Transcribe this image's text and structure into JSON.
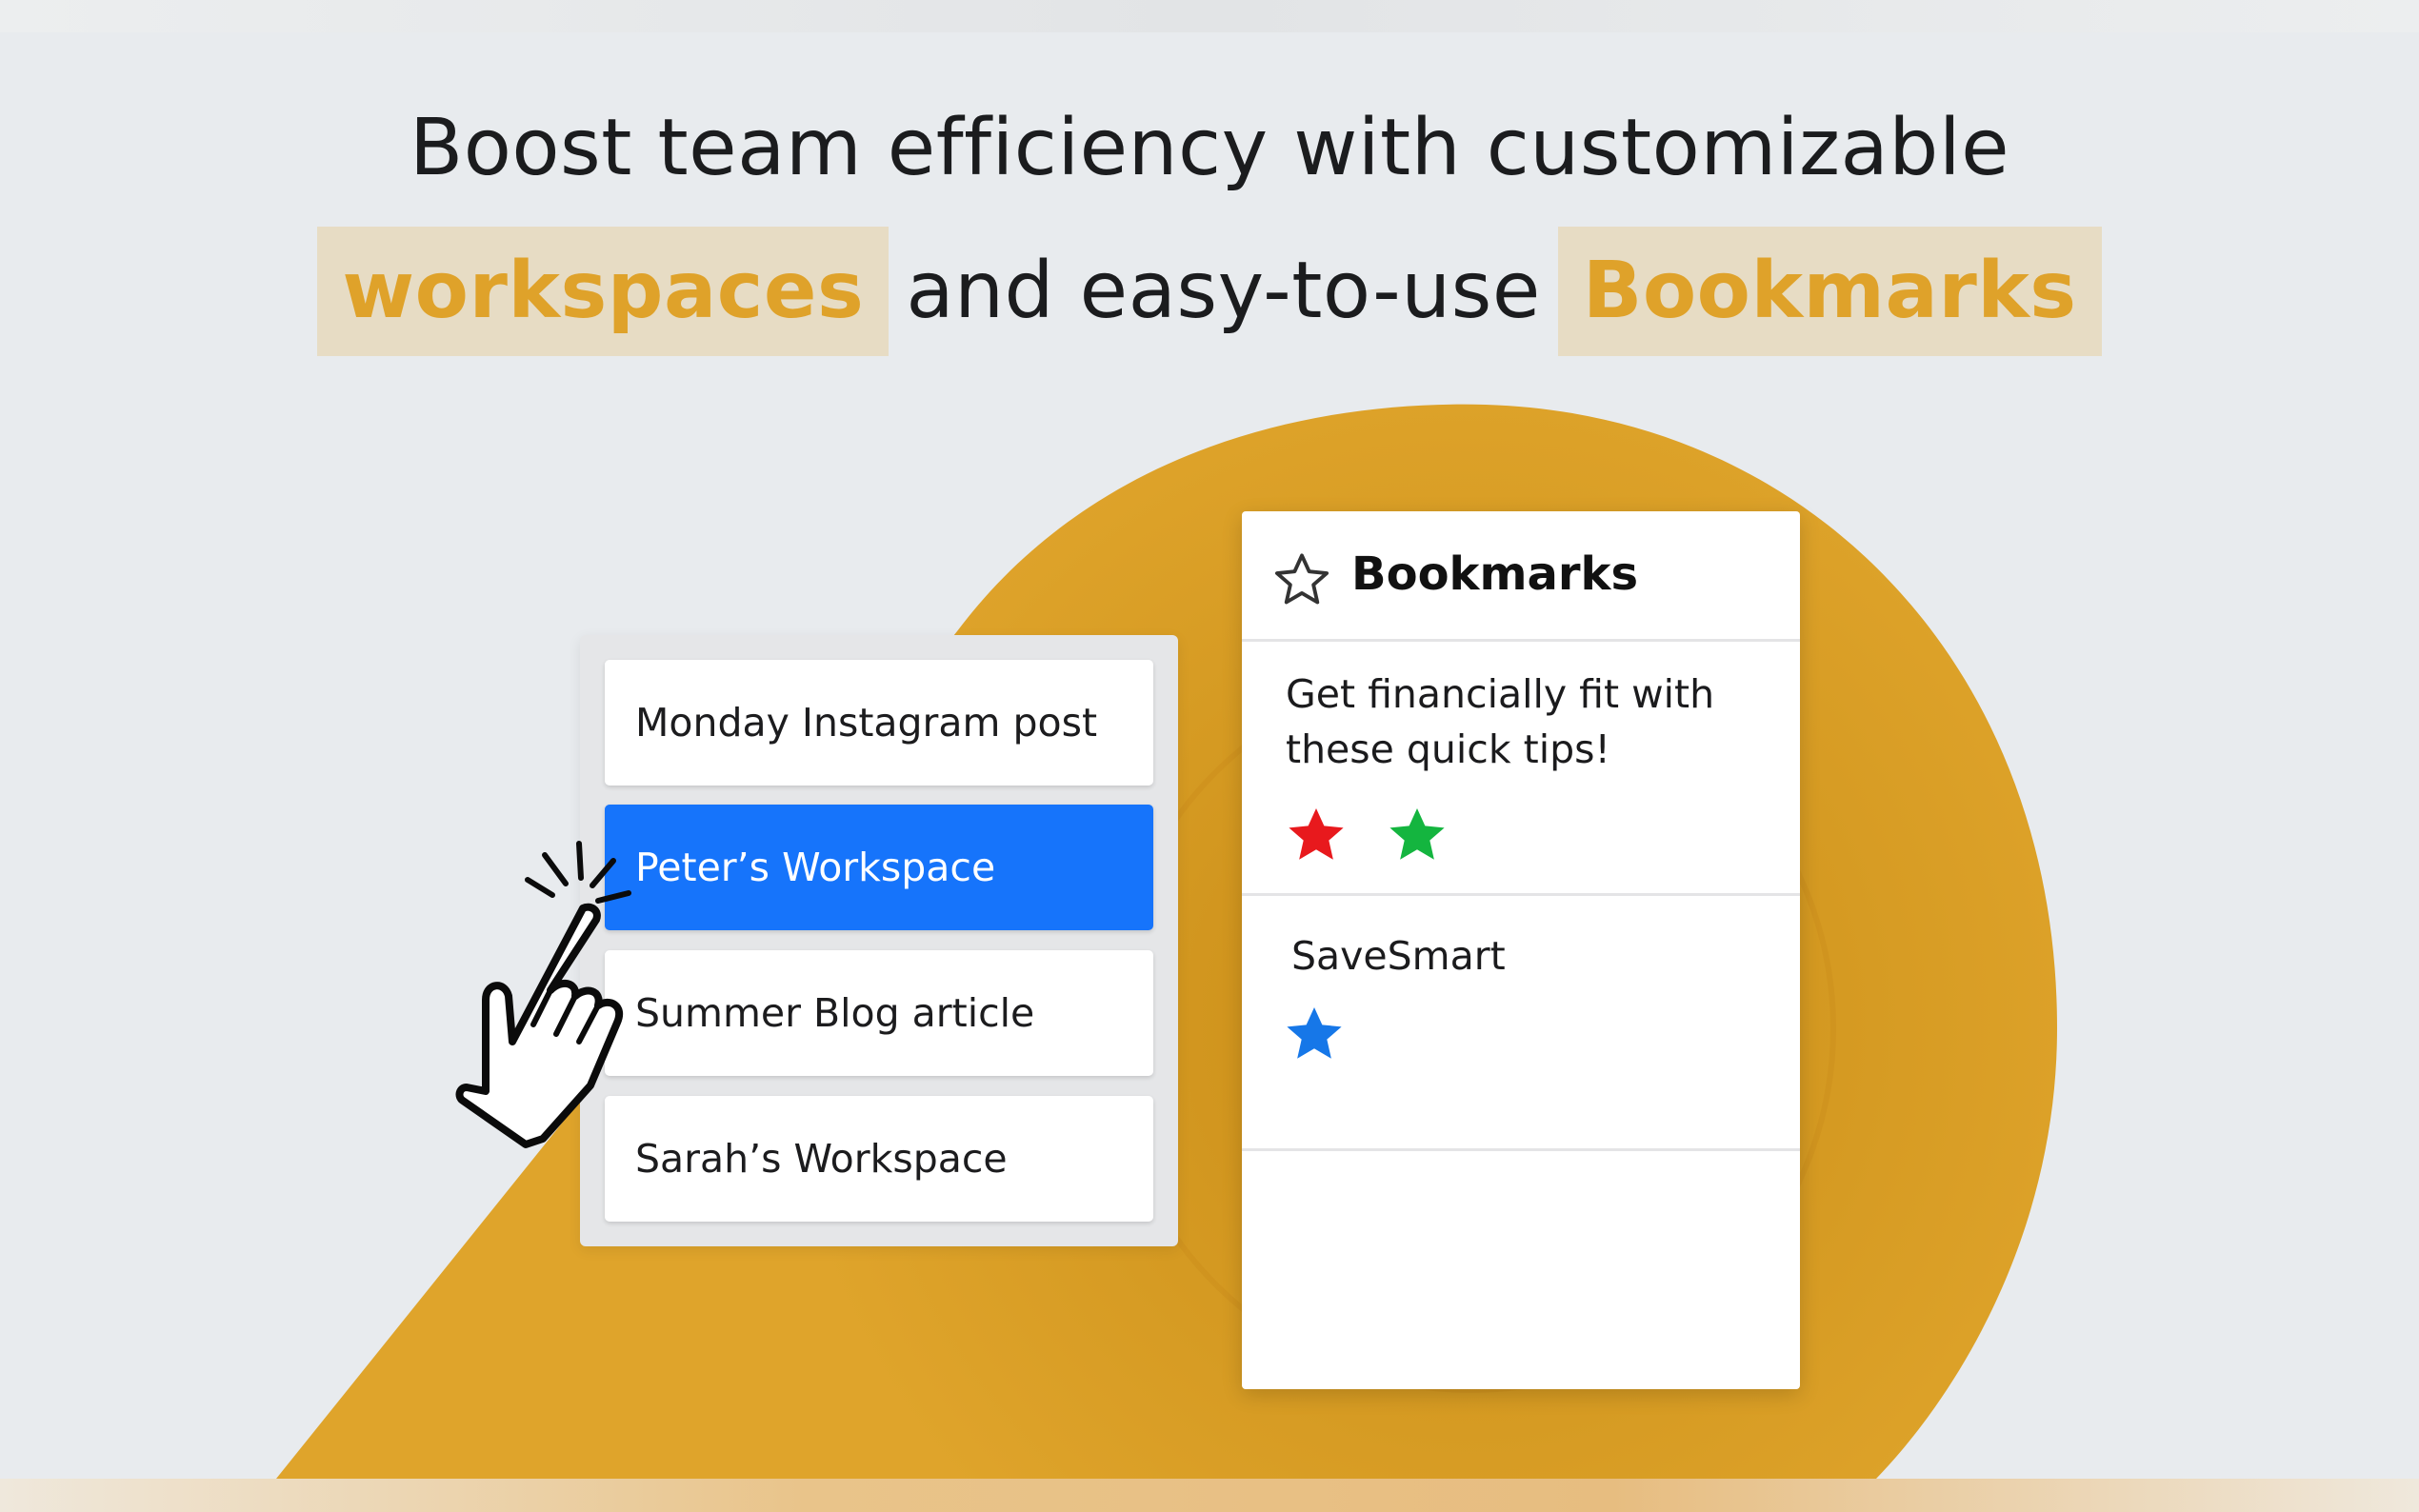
{
  "headline": {
    "line1": "Boost team efficiency with customizable",
    "highlight_left": "workspaces",
    "middle": "and easy-to-use",
    "highlight_right": "Bookmarks"
  },
  "workspaces": {
    "items": [
      {
        "label": "Monday Instagram post",
        "selected": false
      },
      {
        "label": "Peter’s Workspace",
        "selected": true
      },
      {
        "label": "Summer Blog article",
        "selected": false
      },
      {
        "label": "Sarah’s Workspace",
        "selected": false
      }
    ]
  },
  "bookmarks": {
    "title": "Bookmarks",
    "header_icon": "star-outline-icon",
    "entries": [
      {
        "text": "Get financially fit with these quick tips!",
        "stars": [
          "#e8191d",
          "#14b53f"
        ]
      },
      {
        "text": "SaveSmart",
        "stars": [
          "#1677e8"
        ]
      }
    ]
  },
  "cursor": {
    "icon": "pointing-hand-click-icon"
  },
  "colors": {
    "background": "#e8ebee",
    "accent": "#dfa22a",
    "highlight_bg": "#e7dcc4",
    "selected_blue": "#1674fb"
  }
}
